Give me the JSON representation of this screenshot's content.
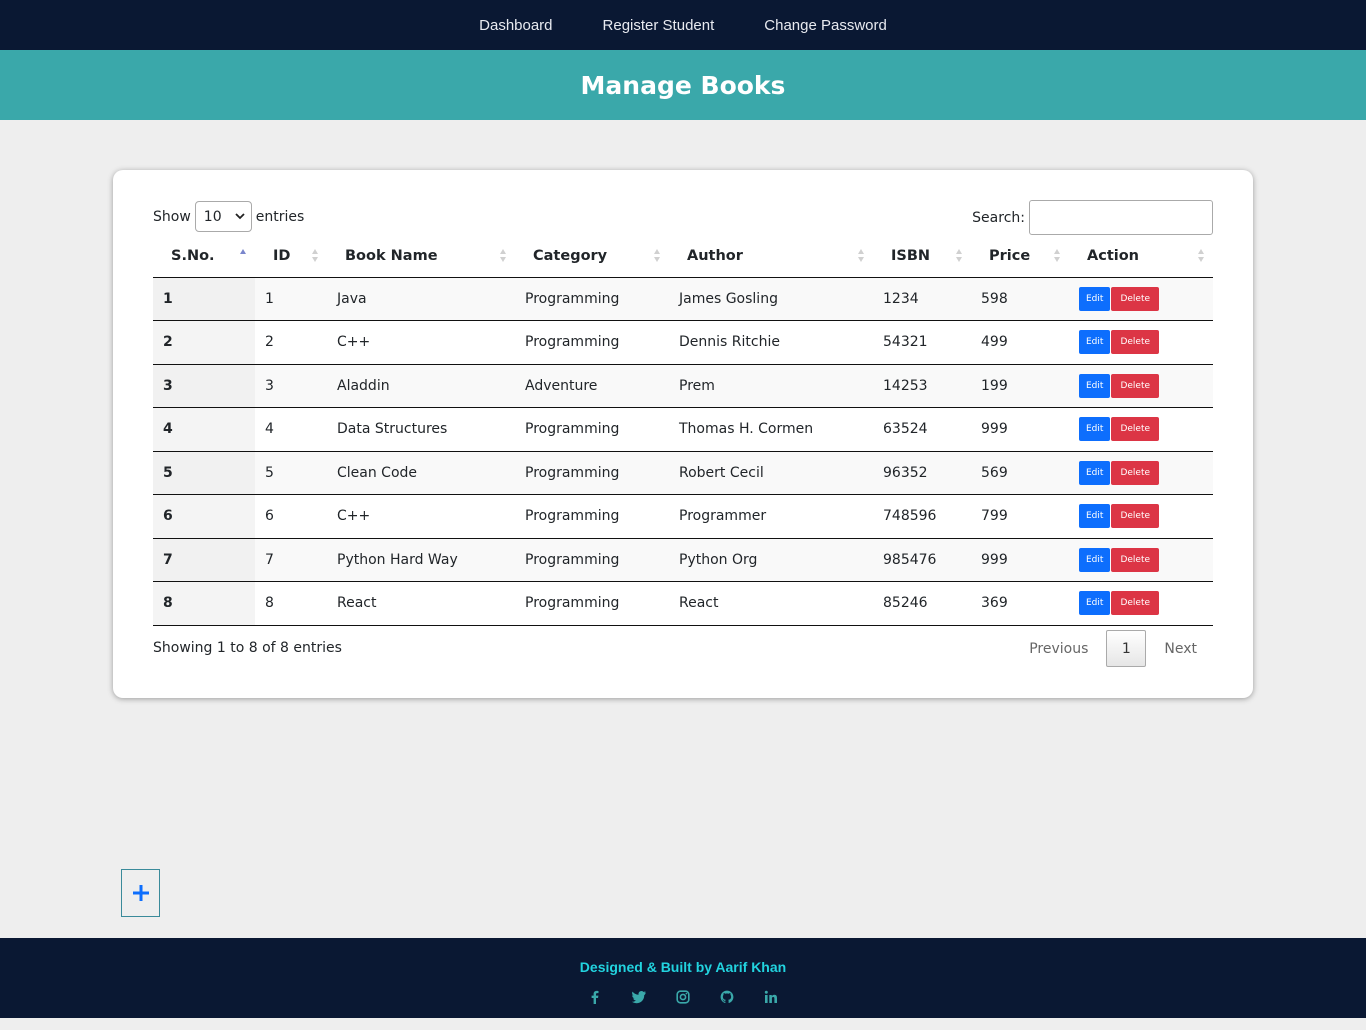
{
  "nav": {
    "items": [
      "Dashboard",
      "Register Student",
      "Change Password"
    ]
  },
  "page": {
    "title": "Manage Books"
  },
  "table_controls": {
    "show_label": "Show",
    "entries_value": "10",
    "entries_label": "entries",
    "search_label": "Search:",
    "search_value": ""
  },
  "table": {
    "columns": [
      "S.No.",
      "ID",
      "Book Name",
      "Category",
      "Author",
      "ISBN",
      "Price",
      "Action"
    ],
    "rows": [
      {
        "sn": "1",
        "id": "1",
        "name": "Java",
        "category": "Programming",
        "author": "James Gosling",
        "isbn": "1234",
        "price": "598"
      },
      {
        "sn": "2",
        "id": "2",
        "name": "C++",
        "category": "Programming",
        "author": "Dennis Ritchie",
        "isbn": "54321",
        "price": "499"
      },
      {
        "sn": "3",
        "id": "3",
        "name": "Aladdin",
        "category": "Adventure",
        "author": "Prem",
        "isbn": "14253",
        "price": "199"
      },
      {
        "sn": "4",
        "id": "4",
        "name": "Data Structures",
        "category": "Programming",
        "author": "Thomas H. Cormen",
        "isbn": "63524",
        "price": "999"
      },
      {
        "sn": "5",
        "id": "5",
        "name": "Clean Code",
        "category": "Programming",
        "author": "Robert Cecil",
        "isbn": "96352",
        "price": "569"
      },
      {
        "sn": "6",
        "id": "6",
        "name": "C++",
        "category": "Programming",
        "author": "Programmer",
        "isbn": "748596",
        "price": "799"
      },
      {
        "sn": "7",
        "id": "7",
        "name": "Python Hard Way",
        "category": "Programming",
        "author": "Python Org",
        "isbn": "985476",
        "price": "999"
      },
      {
        "sn": "8",
        "id": "8",
        "name": "React",
        "category": "Programming",
        "author": "React",
        "isbn": "85246",
        "price": "369"
      }
    ],
    "edit_label": "Edit",
    "delete_label": "Delete",
    "sorted_column": "S.No.",
    "sort_direction": "ascending"
  },
  "pagination": {
    "info": "Showing 1 to 8 of 8 entries",
    "previous": "Previous",
    "current_page": "1",
    "next": "Next"
  },
  "add_button": {
    "icon": "plus-icon"
  },
  "footer": {
    "credit": "Designed & Built by Aarif Khan",
    "social_icons": [
      "facebook-icon",
      "twitter-icon",
      "instagram-icon",
      "github-icon",
      "linkedin-icon"
    ]
  },
  "colors": {
    "nav_bg": "#0a1833",
    "banner_bg": "#3aa8aa",
    "edit_button": "#0d6efd",
    "delete_button": "#dc3545",
    "footer_credit": "#22d3df"
  }
}
